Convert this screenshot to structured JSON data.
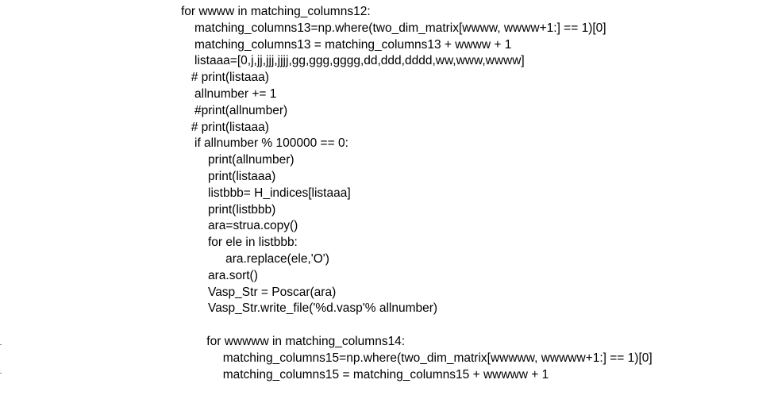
{
  "code_lines": [
    {
      "text": "for wwww in matching_columns12:",
      "indent": 0
    },
    {
      "text": "matching_columns13=np.where(two_dim_matrix[wwww, wwww+1:] == 1)[0]",
      "indent": 1
    },
    {
      "text": "matching_columns13 = matching_columns13 + wwww + 1",
      "indent": 1
    },
    {
      "text": "listaaa=[0,j,jj,jjj,jjjj,gg,ggg,gggg,dd,ddd,dddd,ww,www,wwww]",
      "indent": 1
    },
    {
      "text": "# print(listaaa)",
      "indent": 0.75
    },
    {
      "text": "allnumber += 1",
      "indent": 1
    },
    {
      "text": "#print(allnumber)",
      "indent": 1
    },
    {
      "text": "# print(listaaa)",
      "indent": 0.75
    },
    {
      "text": "if allnumber % 100000 == 0:",
      "indent": 1
    },
    {
      "text": "print(allnumber)",
      "indent": 2
    },
    {
      "text": "print(listaaa)",
      "indent": 2
    },
    {
      "text": "listbbb= H_indices[listaaa]",
      "indent": 2
    },
    {
      "text": "print(listbbb)",
      "indent": 2
    },
    {
      "text": "ara=strua.copy()",
      "indent": 2
    },
    {
      "text": "for ele in listbbb:",
      "indent": 2
    },
    {
      "text": "ara.replace(ele,'O')",
      "indent": 3.3
    },
    {
      "text": "ara.sort()",
      "indent": 2
    },
    {
      "text": "Vasp_Str = Poscar(ara)",
      "indent": 2
    },
    {
      "text": "Vasp_Str.write_file('%d.vasp'% allnumber)",
      "indent": 2
    },
    {
      "text": "",
      "indent": 0
    },
    {
      "text": "for wwwww in matching_columns14:",
      "indent": 1.9
    },
    {
      "text": "matching_columns15=np.where(two_dim_matrix[wwwww, wwwww+1:] == 1)[0]",
      "indent": 3.1
    },
    {
      "text": "matching_columns15 = matching_columns15 + wwwww + 1",
      "indent": 3.1
    }
  ]
}
